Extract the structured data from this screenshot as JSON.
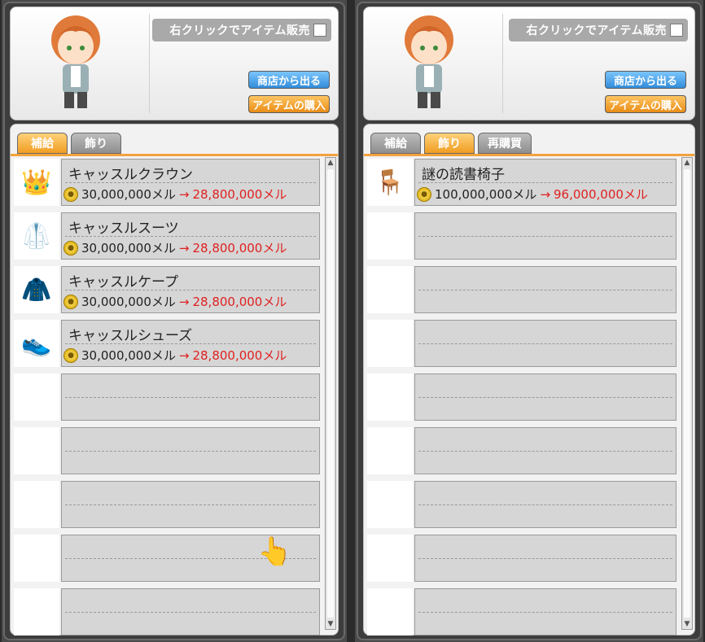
{
  "panels": [
    {
      "id": "left",
      "sell_toggle": "右クリックでアイテム販売",
      "exit_button": "商店から出る",
      "buy_button": "アイテムの購入",
      "tabs": [
        {
          "label": "補給",
          "active": true
        },
        {
          "label": "飾り",
          "active": false
        }
      ],
      "items": [
        {
          "name": "キャッスルクラウン",
          "icon": "crown-icon",
          "original_price": "30,000,000メル",
          "arrow": "→",
          "sale_price": "28,800,000メル"
        },
        {
          "name": "キャッスルスーツ",
          "icon": "suit-icon",
          "original_price": "30,000,000メル",
          "arrow": "→",
          "sale_price": "28,800,000メル"
        },
        {
          "name": "キャッスルケープ",
          "icon": "cape-icon",
          "original_price": "30,000,000メル",
          "arrow": "→",
          "sale_price": "28,800,000メル"
        },
        {
          "name": "キャッスルシューズ",
          "icon": "shoes-icon",
          "original_price": "30,000,000メル",
          "arrow": "→",
          "sale_price": "28,800,000メル"
        }
      ],
      "empty_rows": 5
    },
    {
      "id": "right",
      "sell_toggle": "右クリックでアイテム販売",
      "exit_button": "商店から出る",
      "buy_button": "アイテムの購入",
      "tabs": [
        {
          "label": "補給",
          "active": false
        },
        {
          "label": "飾り",
          "active": true
        },
        {
          "label": "再購買",
          "active": false
        }
      ],
      "items": [
        {
          "name": "謎の読書椅子",
          "icon": "chair-icon",
          "original_price": "100,000,000メル",
          "arrow": "→",
          "sale_price": "96,000,000メル"
        }
      ],
      "empty_rows": 8
    }
  ]
}
